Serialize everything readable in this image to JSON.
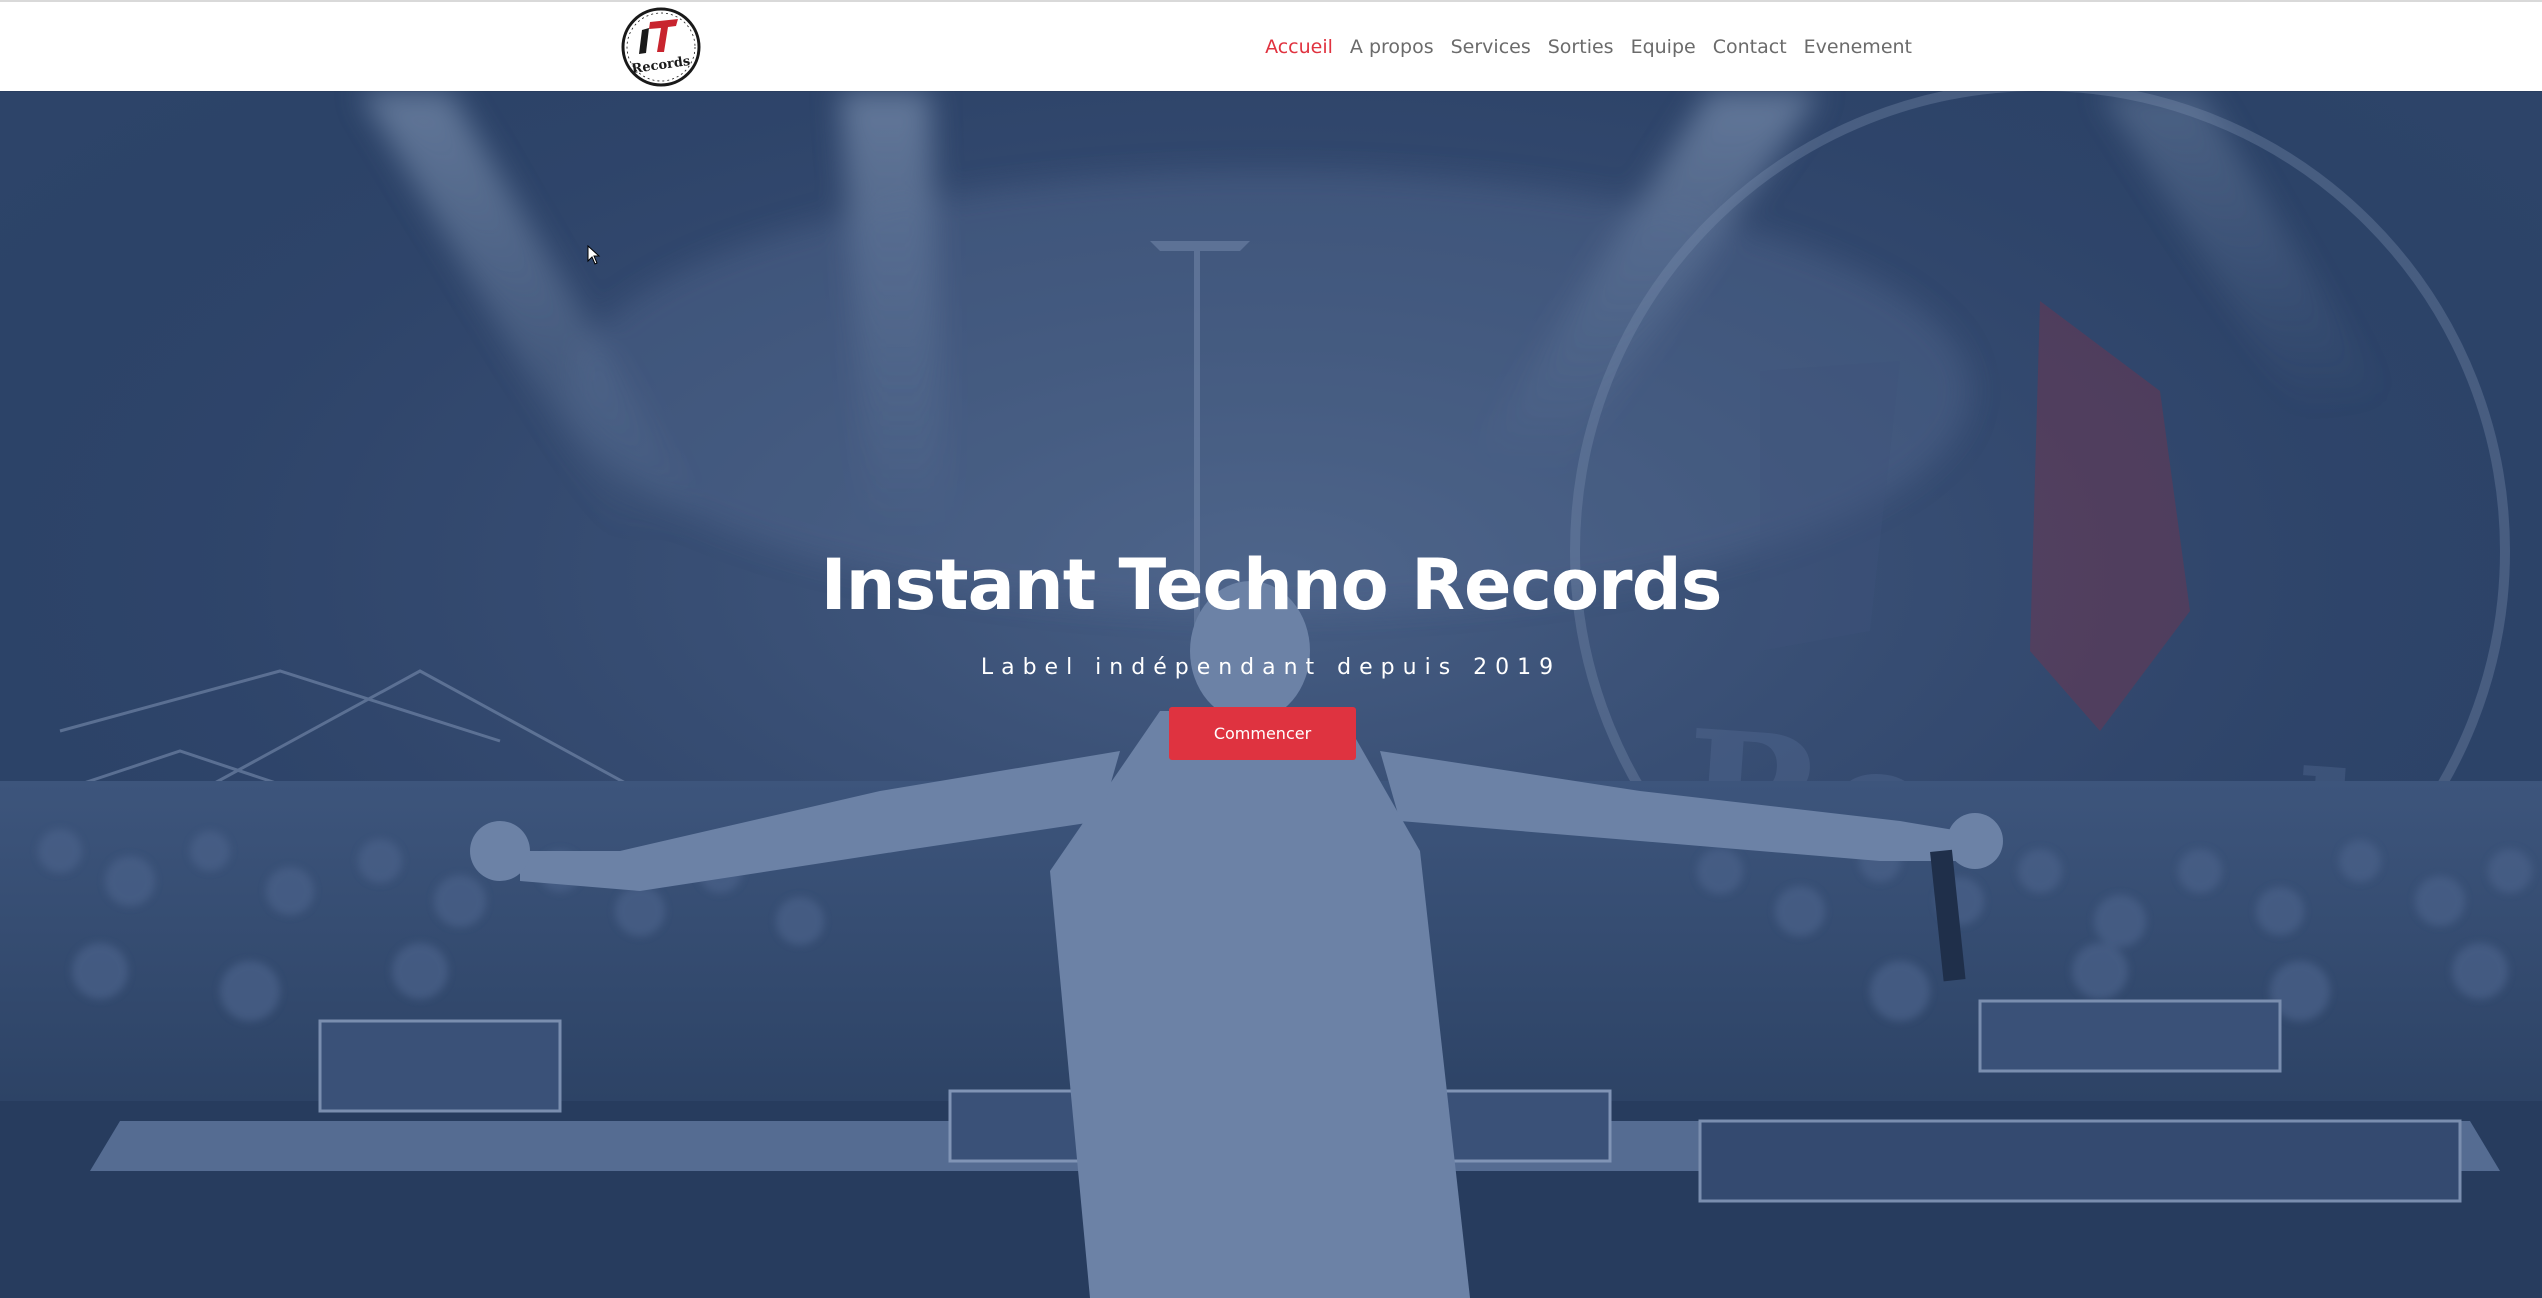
{
  "brand": {
    "logo_text": "IT Records",
    "colors": {
      "accent": "#e0323f",
      "overlay": "#2b4167",
      "nav_text": "#6b6b6b",
      "header_bg": "#ffffff"
    }
  },
  "nav": {
    "items": [
      {
        "label": "Accueil",
        "active": true
      },
      {
        "label": "A propos",
        "active": false
      },
      {
        "label": "Services",
        "active": false
      },
      {
        "label": "Sorties",
        "active": false
      },
      {
        "label": "Equipe",
        "active": false
      },
      {
        "label": "Contact",
        "active": false
      },
      {
        "label": "Evenement",
        "active": false
      }
    ]
  },
  "hero": {
    "title": "Instant Techno Records",
    "subtitle": "Label indépendant depuis 2019",
    "cta_label": "Commencer",
    "background_icon": "dj-crowd-photo",
    "watermark_text": "Records"
  }
}
